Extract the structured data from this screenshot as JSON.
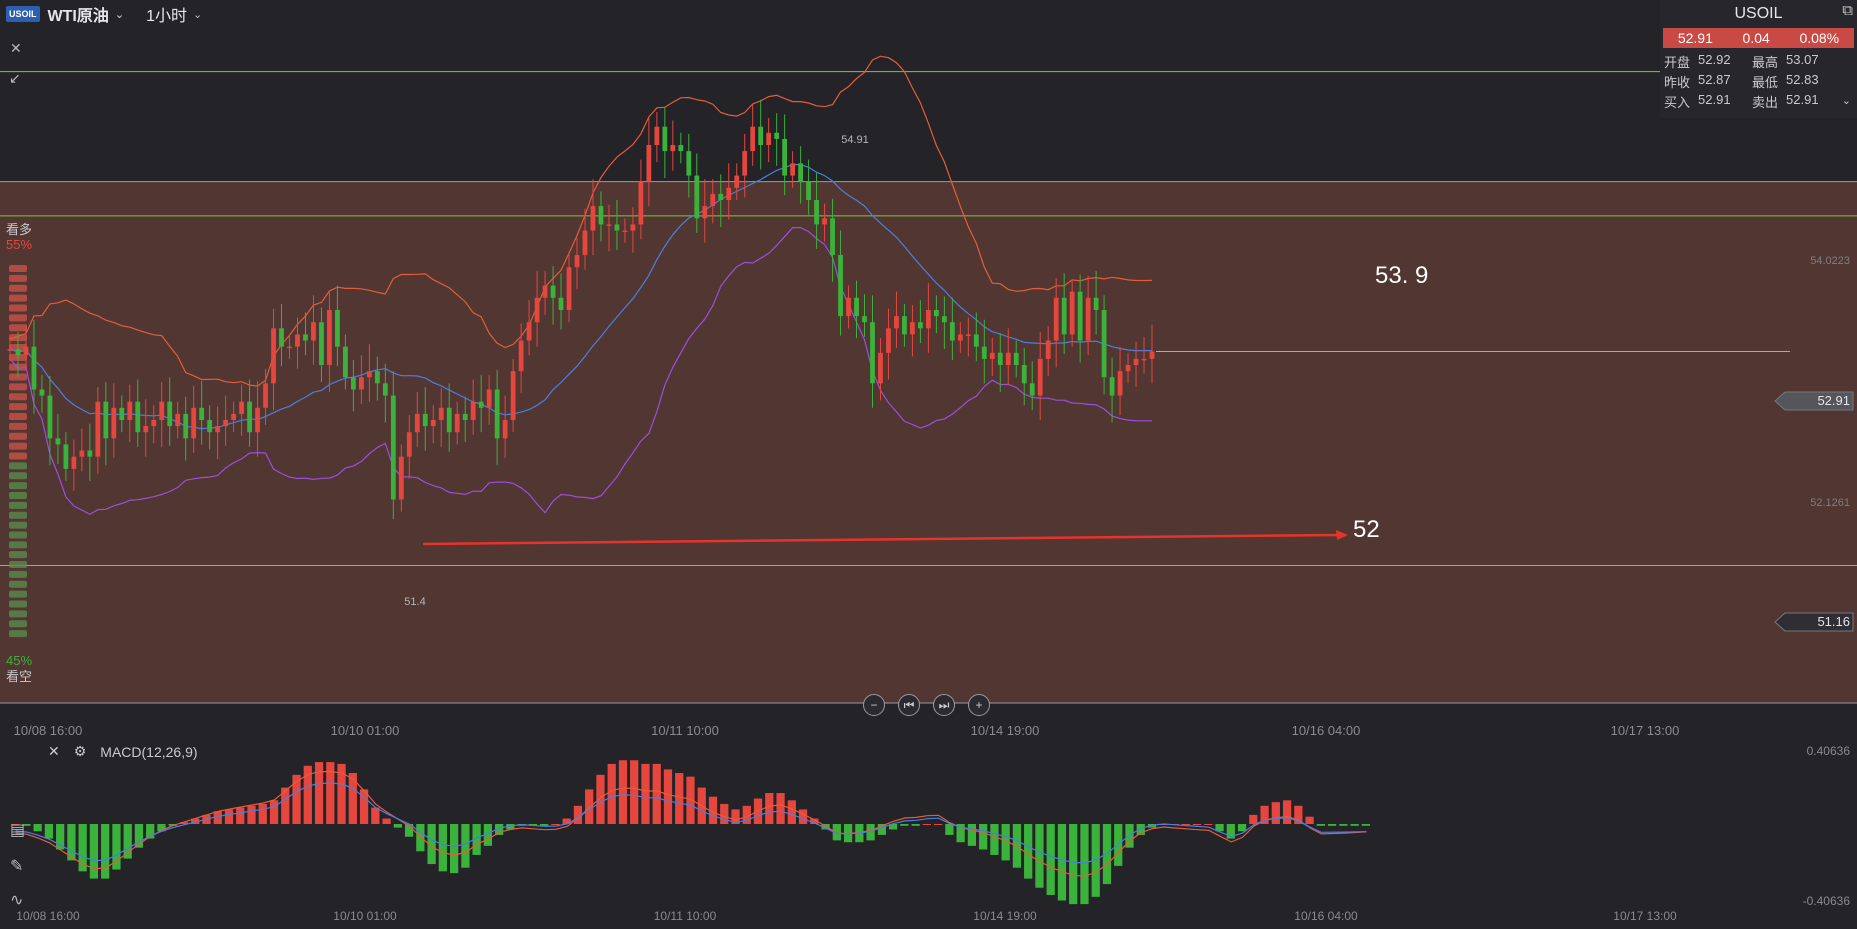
{
  "header": {
    "logo": "USOIL",
    "symbol": "WTI原油",
    "period": "1小时"
  },
  "quote": {
    "symbol": "USOIL",
    "price": "52.91",
    "change": "0.04",
    "change_pct": "0.08%",
    "open_label": "开盘",
    "open": "52.92",
    "high_label": "最高",
    "high": "53.07",
    "prev_close_label": "昨收",
    "prev_close": "52.87",
    "low_label": "最低",
    "low": "52.83",
    "bid_label": "买入",
    "bid": "52.91",
    "ask_label": "卖出",
    "ask": "52.91"
  },
  "sentiment": {
    "bull_label": "看多",
    "bull_pct": "55%",
    "bear_label": "看空",
    "bear_pct": "45%"
  },
  "macd": {
    "label": "MACD(12,26,9)",
    "top_tick": "0.40636",
    "bottom_tick": "-0.40636"
  },
  "colors": {
    "up": "#e5473f",
    "down": "#3bb23c",
    "mid": "#4a7fe0",
    "upper_band": "#e55c3c",
    "lower_band": "#9a4fe0",
    "zone": "#5a3a33",
    "hline": "#7cc940"
  },
  "chart_data": [
    {
      "type": "candlestick",
      "price_tick_labels": [
        "54.0223",
        "52.91",
        "52.1261",
        "51.16"
      ],
      "time_labels": [
        "10/08 16:00",
        "10/10 01:00",
        "10/11 10:00",
        "10/14 19:00",
        "10/16 04:00",
        "10/17 13:00"
      ],
      "annotations": {
        "high_label": "54.91",
        "low_label": "51.4",
        "target_upper": "53. 9",
        "target_lower": "52"
      },
      "ylim": [
        51.0,
        55.5
      ],
      "levels": {
        "upper_green": 55.2,
        "zone_top": 54.3,
        "mid_green": 54.02,
        "current": 52.91,
        "lower_green": 51.16
      },
      "closes": [
        52.93,
        52.88,
        52.95,
        52.6,
        52.55,
        52.2,
        52.15,
        51.95,
        52.05,
        52.1,
        52.05,
        52.5,
        52.2,
        52.45,
        52.35,
        52.5,
        52.25,
        52.3,
        52.35,
        52.5,
        52.3,
        52.4,
        52.2,
        52.45,
        52.35,
        52.25,
        52.3,
        52.35,
        52.4,
        52.5,
        52.25,
        52.45,
        52.65,
        53.1,
        52.95,
        52.95,
        53.05,
        53.0,
        53.15,
        52.8,
        53.25,
        52.95,
        52.7,
        52.6,
        52.7,
        52.75,
        52.65,
        52.55,
        51.7,
        52.05,
        52.25,
        52.4,
        52.3,
        52.35,
        52.45,
        52.25,
        52.4,
        52.35,
        52.5,
        52.45,
        52.6,
        52.2,
        52.35,
        52.75,
        53.0,
        53.15,
        53.35,
        53.45,
        53.35,
        53.25,
        53.6,
        53.7,
        53.9,
        54.1,
        53.95,
        53.95,
        53.9,
        53.9,
        53.95,
        54.3,
        54.6,
        54.75,
        54.55,
        54.6,
        54.55,
        54.35,
        54.0,
        54.1,
        54.2,
        54.15,
        54.25,
        54.35,
        54.55,
        54.75,
        54.6,
        54.7,
        54.65,
        54.35,
        54.45,
        54.3,
        54.15,
        53.95,
        54.0,
        53.7,
        53.2,
        53.35,
        53.2,
        53.15,
        52.65,
        52.9,
        53.1,
        53.2,
        53.05,
        53.15,
        53.1,
        53.25,
        53.2,
        53.15,
        53.0,
        53.05,
        53.05,
        52.95,
        52.85,
        52.9,
        52.8,
        52.9,
        52.8,
        52.65,
        52.55,
        52.85,
        53.0,
        53.35,
        53.05,
        53.4,
        53.0,
        53.35,
        53.25,
        52.7,
        52.55,
        52.75,
        52.8,
        52.85,
        52.85,
        52.91
      ]
    },
    {
      "type": "bar",
      "name": "MACD histogram",
      "values": [
        0,
        -0.01,
        -0.04,
        -0.08,
        -0.14,
        -0.2,
        -0.26,
        -0.3,
        -0.3,
        -0.25,
        -0.19,
        -0.13,
        -0.08,
        -0.04,
        -0.01,
        0.01,
        0.03,
        0.05,
        0.07,
        0.08,
        0.09,
        0.1,
        0.11,
        0.13,
        0.2,
        0.27,
        0.32,
        0.34,
        0.34,
        0.33,
        0.28,
        0.19,
        0.09,
        0.03,
        -0.02,
        -0.07,
        -0.15,
        -0.22,
        -0.26,
        -0.27,
        -0.24,
        -0.17,
        -0.12,
        -0.06,
        -0.03,
        -0.01,
        -0.01,
        -0.01,
        0.0,
        0.03,
        0.1,
        0.19,
        0.27,
        0.33,
        0.35,
        0.35,
        0.33,
        0.33,
        0.3,
        0.28,
        0.26,
        0.2,
        0.15,
        0.11,
        0.08,
        0.1,
        0.14,
        0.17,
        0.17,
        0.13,
        0.08,
        0.03,
        -0.03,
        -0.09,
        -0.1,
        -0.1,
        -0.09,
        -0.06,
        -0.03,
        -0.01,
        -0.01,
        0.0,
        0.0,
        -0.06,
        -0.1,
        -0.12,
        -0.14,
        -0.17,
        -0.2,
        -0.24,
        -0.3,
        -0.35,
        -0.39,
        -0.42,
        -0.44,
        -0.44,
        -0.4,
        -0.33,
        -0.23,
        -0.13,
        -0.06,
        -0.02,
        0.0,
        0.0,
        0.0,
        0.0,
        0.0,
        -0.04,
        -0.08,
        -0.04,
        0.05,
        0.1,
        0.12,
        0.13,
        0.1,
        0.04,
        -0.01,
        -0.01,
        -0.01,
        -0.01,
        -0.01
      ],
      "ylim": [
        -0.40636,
        0.40636
      ]
    }
  ]
}
